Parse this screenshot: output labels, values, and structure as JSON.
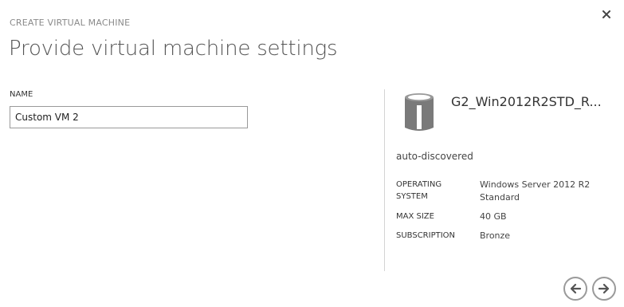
{
  "dialog": {
    "eyebrow": "CREATE VIRTUAL MACHINE",
    "title": "Provide virtual machine settings"
  },
  "form": {
    "name_label": "NAME",
    "name_value": "Custom VM 2"
  },
  "image_info": {
    "image_name": "G2_Win2012R2STD_R...",
    "source": "auto-discovered",
    "properties": [
      {
        "key_line1": "OPERATING",
        "key_line2": "SYSTEM",
        "value_line1": "Windows Server 2012 R2",
        "value_line2": "Standard"
      },
      {
        "key_line1": "MAX SIZE",
        "value_line1": "40 GB"
      },
      {
        "key_line1": "SUBSCRIPTION",
        "value_line1": "Bronze"
      }
    ]
  },
  "icons": {
    "close": "close-icon",
    "disk": "disk-icon",
    "back": "arrow-left-icon",
    "next": "arrow-right-icon"
  },
  "colors": {
    "text": "#333333",
    "muted": "#8a8a8a",
    "border": "#9a9a9a",
    "disk": "#7a7a7a"
  }
}
